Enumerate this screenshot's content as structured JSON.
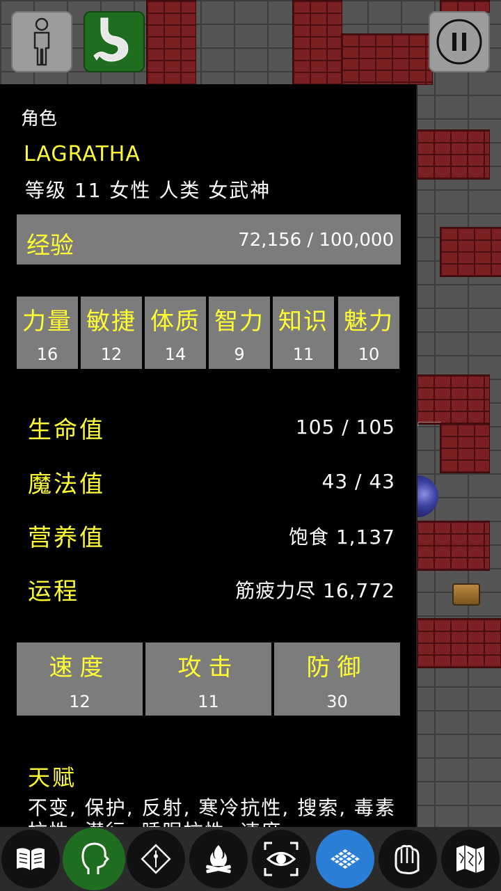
{
  "header": {
    "character_button_icon": "person-silhouette-icon",
    "status_button_icon": "stomach-icon",
    "pause_button_icon": "pause-icon"
  },
  "panel": {
    "section_label": "角色",
    "character": {
      "name": "LAGRATHA",
      "description": "等级 11 女性 人类 女武神"
    },
    "experience": {
      "label": "经验",
      "value": "72,156 / 100,000"
    },
    "attributes": [
      {
        "name": "力量",
        "value": "16"
      },
      {
        "name": "敏捷",
        "value": "12"
      },
      {
        "name": "体质",
        "value": "14"
      },
      {
        "name": "智力",
        "value": "9"
      },
      {
        "name": "知识",
        "value": "11"
      },
      {
        "name": "魅力",
        "value": "10"
      }
    ],
    "stats": [
      {
        "name": "生命值",
        "value": "105 / 105"
      },
      {
        "name": "魔法值",
        "value": "43 / 43"
      },
      {
        "name": "营养值",
        "value": "饱食 1,137"
      },
      {
        "name": "运程",
        "value": "筋疲力尽 16,772"
      }
    ],
    "combat": [
      {
        "name": "速度",
        "value": "12"
      },
      {
        "name": "攻击",
        "value": "11"
      },
      {
        "name": "防御",
        "value": "30"
      }
    ],
    "talents": {
      "title": "天赋",
      "text": "不变, 保护, 反射, 寒冷抗性, 搜索, 毒素抗性, 潜行, 睡眠抗性, 速度"
    }
  },
  "toolbar": {
    "items": [
      {
        "icon": "book-icon"
      },
      {
        "icon": "head-profile-icon"
      },
      {
        "icon": "spell-diamond-icon"
      },
      {
        "icon": "campfire-icon"
      },
      {
        "icon": "eye-search-icon"
      },
      {
        "icon": "map-grid-icon"
      },
      {
        "icon": "hands-icon"
      },
      {
        "icon": "folded-map-icon"
      }
    ]
  },
  "colors": {
    "panel_bg": "#000000",
    "box_bg": "#7c7c7c",
    "label_yellow": "#ffff33",
    "active_green": "#1f6e1f",
    "active_blue": "#2a7ed6"
  }
}
